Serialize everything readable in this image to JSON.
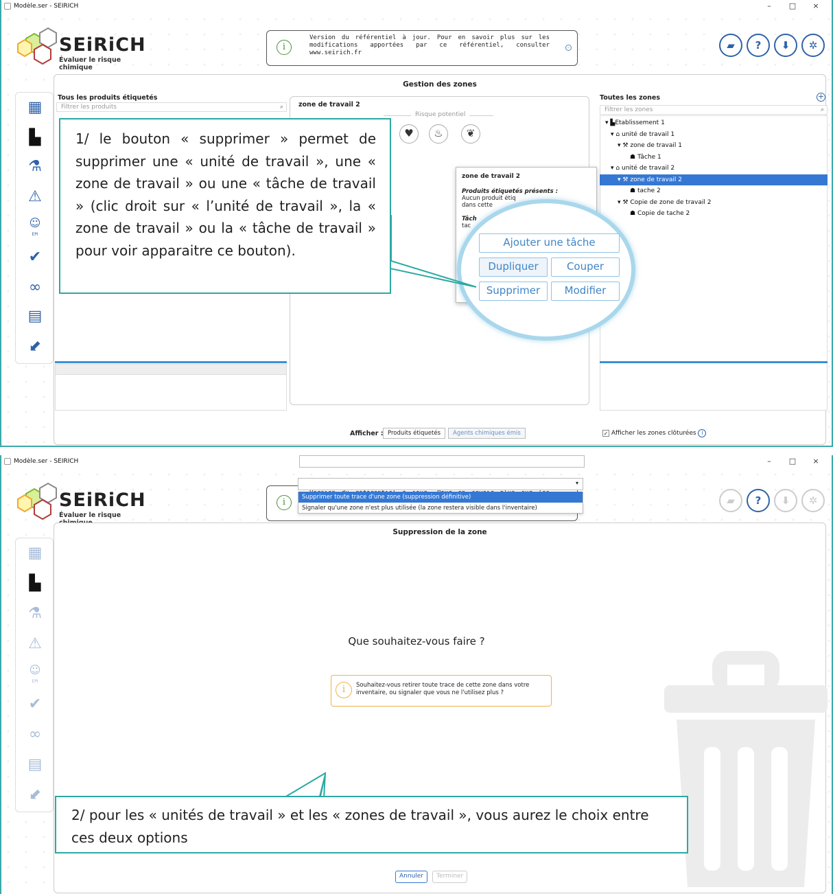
{
  "window": {
    "title": "Modèle.ser - SEIRICH",
    "controls": {
      "minimize": "–",
      "maximize": "□",
      "close": "×"
    }
  },
  "brand": {
    "name": "SEiRiCH",
    "tagline": "Évaluer le risque chimique"
  },
  "notice": {
    "text": "Version du référentiel à jour. Pour en savoir plus sur les modifications apportées par ce référentiel, consulter www.seirich.fr"
  },
  "toolbar": {
    "icons": [
      "folder-open-icon",
      "help-icon",
      "download-icon",
      "gear-icon"
    ]
  },
  "sidebar": {
    "icons": [
      "dashboard-icon",
      "factory-icon",
      "flask-icon",
      "warning-icon",
      "ppe-icon",
      "check-icon",
      "binoculars-icon",
      "calculator-icon",
      "export-icon"
    ],
    "epi_label": "EPI"
  },
  "screen1": {
    "title": "Gestion des zones",
    "left": {
      "label": "Tous les produits étiquetés",
      "filter_placeholder": "Filtrer les produits"
    },
    "center": {
      "zone_title": "zone de travail 2",
      "risk_label": "Risque potentiel",
      "risk_icons": [
        "heart-icon",
        "flame-icon",
        "leaf-icon"
      ]
    },
    "right": {
      "label": "Toutes les zones",
      "filter_placeholder": "Filtrer les zones",
      "tree": [
        {
          "text": "Etablissement 1",
          "icon": "factory-icon"
        },
        {
          "text": "unité de travail 1",
          "icon": "home-icon"
        },
        {
          "text": "zone de travail 1",
          "icon": "tools-icon"
        },
        {
          "text": "Tâche 1",
          "icon": "person-icon"
        },
        {
          "text": "unité de travail 2",
          "icon": "home-icon"
        },
        {
          "text": "zone de travail 2",
          "icon": "tools-icon",
          "selected": true
        },
        {
          "text": "tache 2",
          "icon": "person-icon"
        },
        {
          "text": "Copie de zone de travail 2",
          "icon": "tools-icon"
        },
        {
          "text": "Copie de tache 2",
          "icon": "person-icon"
        }
      ]
    },
    "popup": {
      "title": "zone de travail 2",
      "products_heading": "Produits étiquetés présents :",
      "products_text_1": "Aucun produit étiq",
      "products_text_2": "dans cette",
      "tasks_heading": "Tâch",
      "tasks_text": "tac"
    },
    "menu": {
      "add_task": "Ajouter une tâche",
      "duplicate": "Dupliquer",
      "cut": "Couper",
      "delete": "Supprimer",
      "edit": "Modifier"
    },
    "callout": "1/ le bouton « supprimer » permet de supprimer une « unité de travail », une « zone de travail » ou une « tâche de travail » (clic droit sur « l’unité de travail », la « zone de travail » ou la « tâche de travail » pour voir apparaitre ce bouton).",
    "footer": {
      "show_label": "Afficher :",
      "seg1": "Produits étiquetés",
      "seg2": "Agents chimiques émis",
      "closed_zones": "Afficher les zones clôturées"
    }
  },
  "screen2": {
    "title": "Suppression de la zone",
    "question": "Que souhaitez-vous faire ?",
    "info": "Souhaitez-vous retirer toute trace de cette zone dans votre inventaire, ou signaler que vous ne l'utilisez plus ?",
    "options": [
      "Supprimer toute trace d'une zone (suppression définitive)",
      "Signaler qu'une zone n'est plus utilisée (la zone restera visible dans l'inventaire)"
    ],
    "callout": "2/ pour les « unités de travail » et les « zones de travail », vous aurez le choix entre ces deux options",
    "cancel": "Annuler",
    "finish": "Terminer"
  }
}
